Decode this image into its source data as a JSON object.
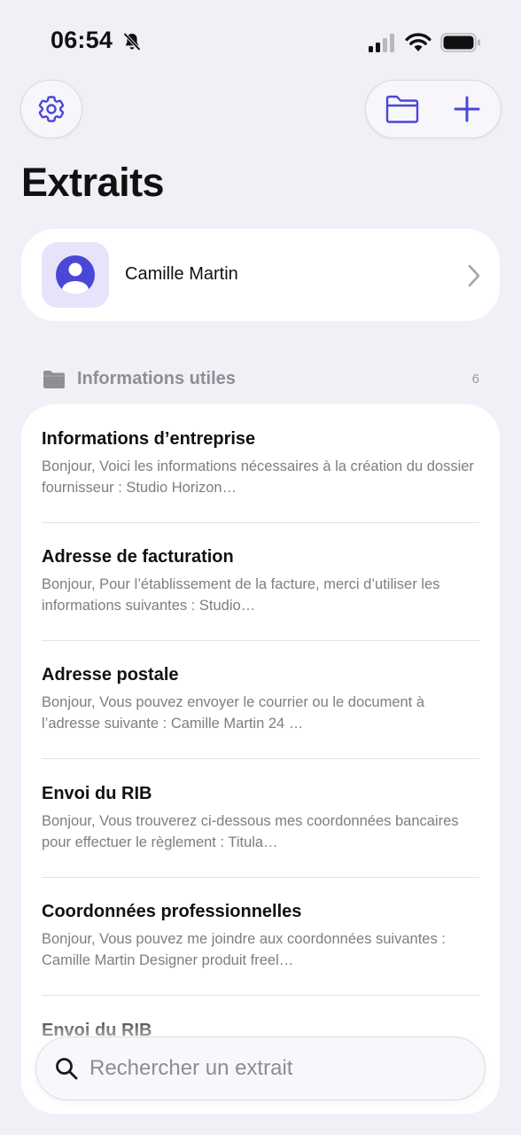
{
  "status_bar": {
    "time": "06:54",
    "icons": [
      "bell-slash-icon",
      "cellular-signal-icon",
      "wifi-icon",
      "battery-icon"
    ]
  },
  "toolbar": {
    "settings_icon": "gear-icon",
    "folder_icon": "folder-icon",
    "add_icon": "plus-icon"
  },
  "page": {
    "title": "Extraits"
  },
  "profile": {
    "name": "Camille Martin",
    "icon": "person-circle-icon"
  },
  "section": {
    "title": "Informations utiles",
    "count": "6",
    "icon": "folder-fill-icon"
  },
  "items": [
    {
      "title": "Informations d’entreprise",
      "preview": "Bonjour,  Voici les informations nécessaires à la création du dossier fournisseur :  Studio Horizon…"
    },
    {
      "title": "Adresse de facturation",
      "preview": "Bonjour,  Pour l’établissement de la facture, merci d’utiliser les informations suivantes :  Studio…"
    },
    {
      "title": "Adresse postale",
      "preview": "Bonjour,  Vous pouvez envoyer le courrier ou le document à l’adresse suivante :  Camille Martin 24 …"
    },
    {
      "title": "Envoi du RIB",
      "preview": "Bonjour,  Vous trouverez ci-dessous mes coordonnées bancaires pour effectuer le règlement :  Titula…"
    },
    {
      "title": "Coordonnées professionnelles",
      "preview": "Bonjour,  Vous pouvez me joindre aux coordonnées suivantes :  Camille Martin Designer produit freel…"
    },
    {
      "title": "Envoi du RIB",
      "preview": ""
    }
  ],
  "search": {
    "placeholder": "Rechercher un extrait",
    "value": ""
  },
  "colors": {
    "accent": "#4b47d6",
    "background": "#f1f0f7",
    "card": "#ffffff",
    "secondary_text": "#7d7d84",
    "avatar_bg": "#e5e4fa"
  }
}
